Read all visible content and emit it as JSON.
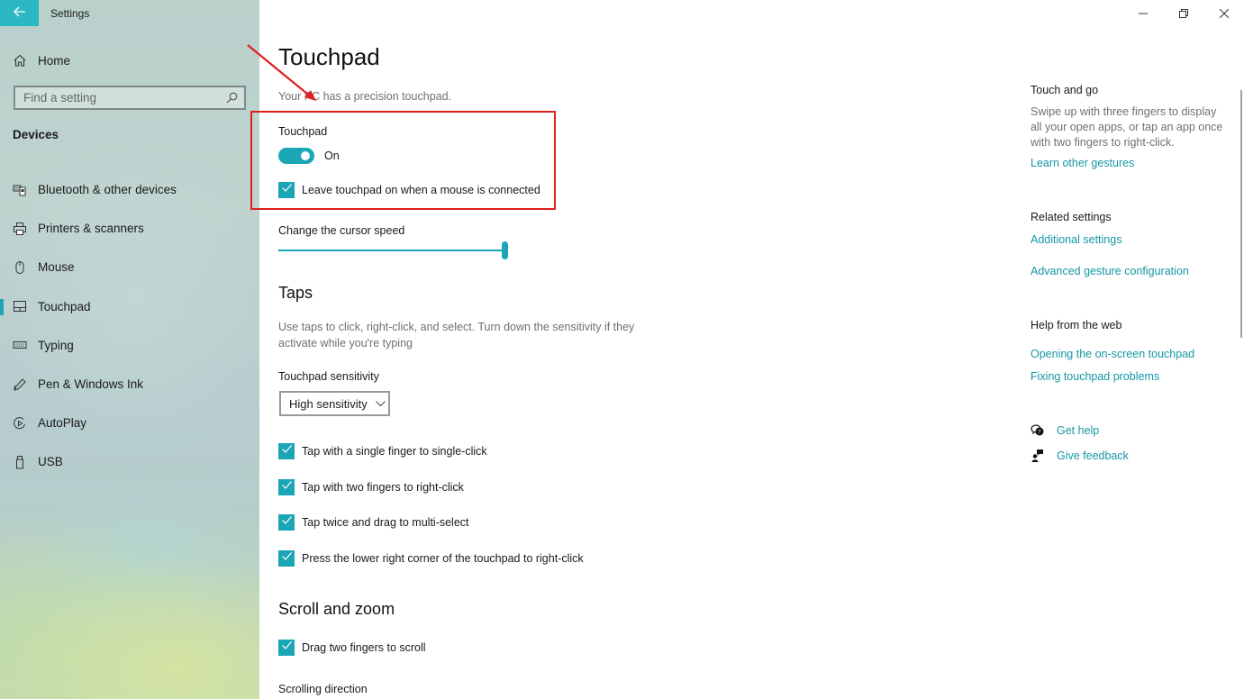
{
  "window": {
    "title": "Settings",
    "controls": {
      "minimize": "minimize-icon",
      "restore": "restore-icon",
      "close": "close-icon"
    }
  },
  "sidebar": {
    "back_icon": "back-arrow-icon",
    "home": {
      "label": "Home",
      "icon": "home-icon"
    },
    "search": {
      "placeholder": "Find a setting",
      "value": "",
      "icon": "search-icon"
    },
    "group_title": "Devices",
    "items": [
      {
        "label": "Bluetooth & other devices",
        "icon": "bluetooth-devices-icon",
        "active": false
      },
      {
        "label": "Printers & scanners",
        "icon": "printer-icon",
        "active": false
      },
      {
        "label": "Mouse",
        "icon": "mouse-icon",
        "active": false
      },
      {
        "label": "Touchpad",
        "icon": "touchpad-icon",
        "active": true
      },
      {
        "label": "Typing",
        "icon": "keyboard-icon",
        "active": false
      },
      {
        "label": "Pen & Windows Ink",
        "icon": "pen-icon",
        "active": false
      },
      {
        "label": "AutoPlay",
        "icon": "autoplay-icon",
        "active": false
      },
      {
        "label": "USB",
        "icon": "usb-icon",
        "active": false
      }
    ]
  },
  "main": {
    "title": "Touchpad",
    "subtitle": "Your PC has a precision touchpad.",
    "touchpad_toggle": {
      "label": "Touchpad",
      "state": "On",
      "on": true
    },
    "leave_on_checkbox": {
      "label": "Leave touchpad on when a mouse is connected",
      "checked": true
    },
    "cursor_speed": {
      "label": "Change the cursor speed",
      "value_percent": 100
    },
    "taps": {
      "title": "Taps",
      "description": "Use taps to click, right-click, and select. Turn down the sensitivity if they activate while you're typing",
      "sensitivity_label": "Touchpad sensitivity",
      "sensitivity_value": "High sensitivity",
      "options": [
        {
          "label": "Tap with a single finger to single-click",
          "checked": true
        },
        {
          "label": "Tap with two fingers to right-click",
          "checked": true
        },
        {
          "label": "Tap twice and drag to multi-select",
          "checked": true
        },
        {
          "label": "Press the lower right corner of the touchpad to right-click",
          "checked": true
        }
      ]
    },
    "scroll_zoom": {
      "title": "Scroll and zoom",
      "options": [
        {
          "label": "Drag two fingers to scroll",
          "checked": true
        }
      ],
      "scrolling_direction_label": "Scrolling direction"
    }
  },
  "right_panel": {
    "touch_and_go": {
      "title": "Touch and go",
      "text": "Swipe up with three fingers to display all your open apps, or tap an app once with two fingers to right-click.",
      "link": "Learn other gestures"
    },
    "related_settings": {
      "title": "Related settings",
      "links": [
        "Additional settings",
        "Advanced gesture configuration"
      ]
    },
    "help_from_web": {
      "title": "Help from the web",
      "links": [
        "Opening the on-screen touchpad",
        "Fixing touchpad problems"
      ]
    },
    "support": [
      {
        "label": "Get help",
        "icon": "get-help-icon"
      },
      {
        "label": "Give feedback",
        "icon": "feedback-icon"
      }
    ]
  },
  "annotation": {
    "color": "#e0201f",
    "type": "red-arrow-and-box"
  },
  "colors": {
    "accent": "#1aa6b5",
    "link": "#1597a5",
    "back_button": "#2bb8c4"
  }
}
